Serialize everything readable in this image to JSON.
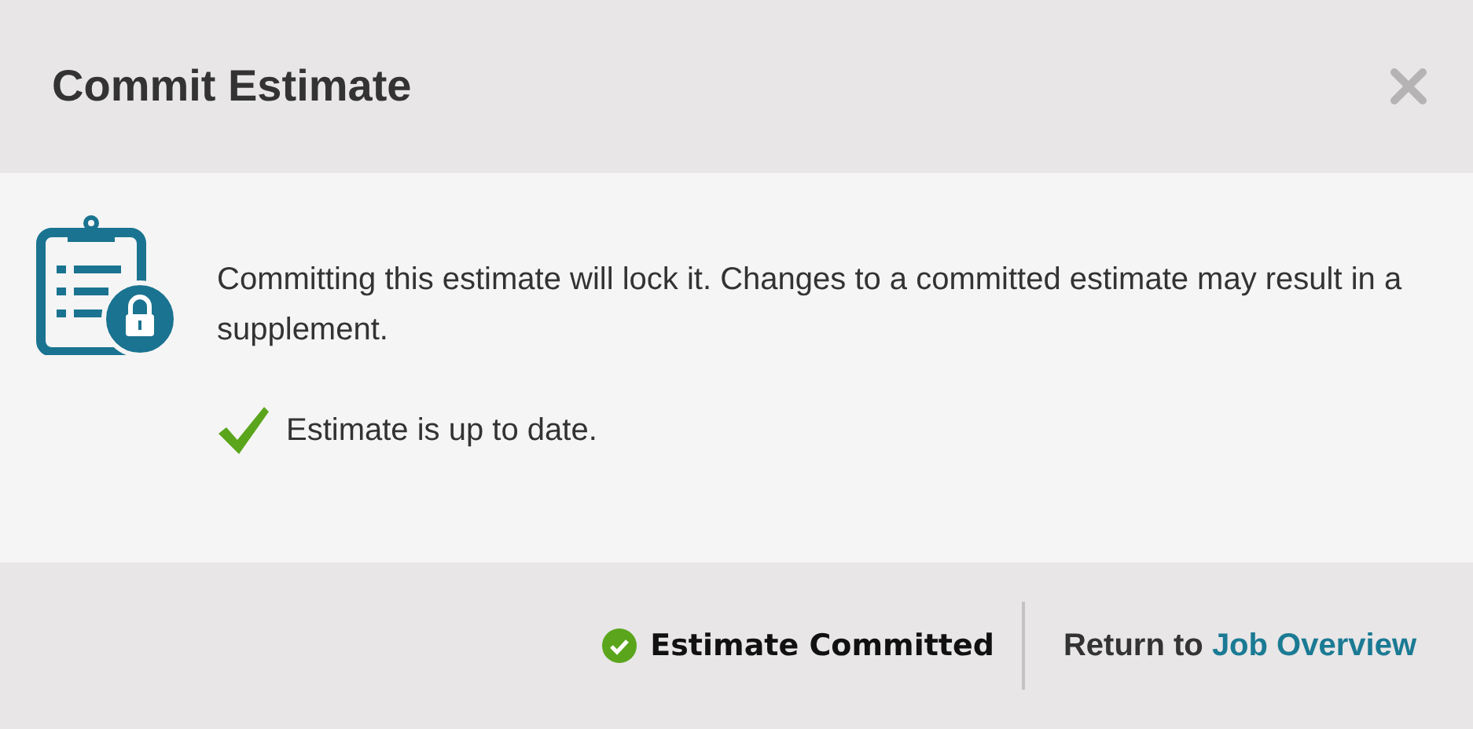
{
  "dialog": {
    "title": "Commit Estimate"
  },
  "body": {
    "message": "Committing this estimate will lock it. Changes to a committed estimate may result in a supplement.",
    "status": "Estimate is up to date."
  },
  "footer": {
    "committed_label": "Estimate Committed",
    "return_prefix": "Return to",
    "return_link": "Job Overview"
  }
}
